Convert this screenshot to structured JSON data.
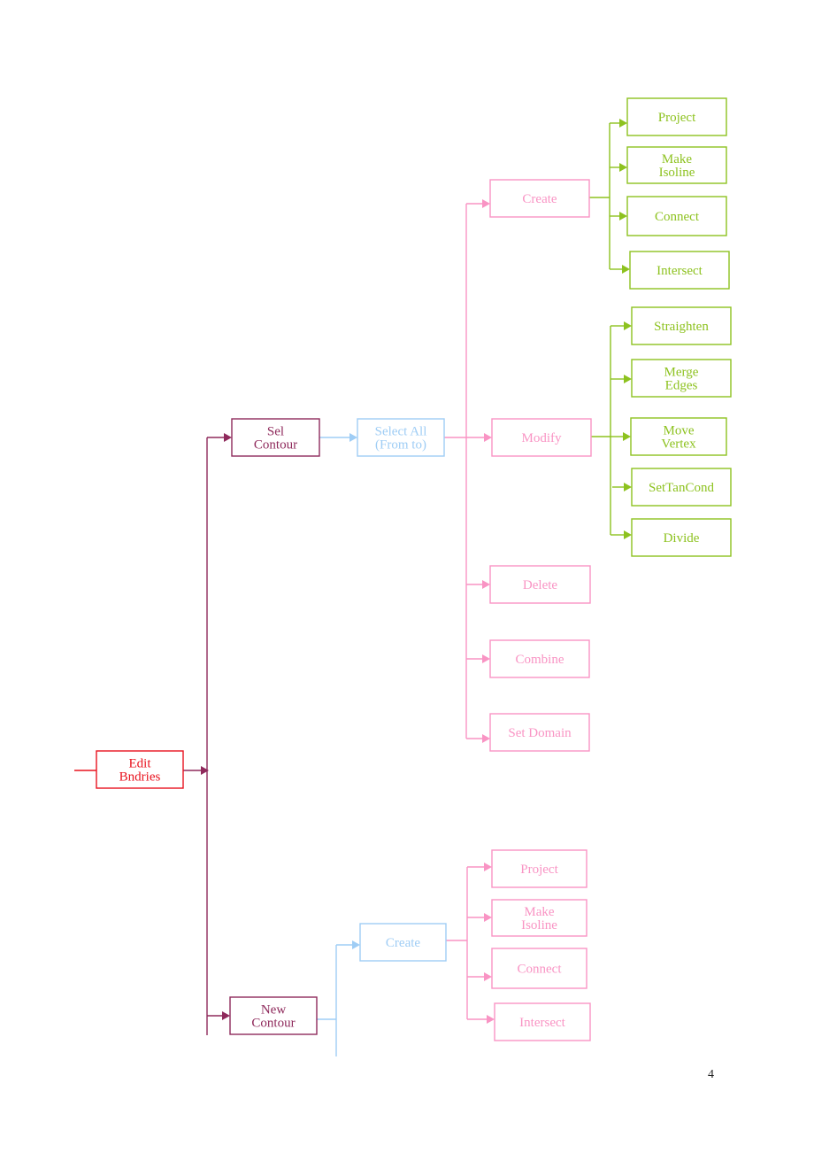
{
  "colors": {
    "root": "#e8121e",
    "level1": "#8f2a5c",
    "level2": "#9fcdf5",
    "level3": "#f994c4",
    "level4": "#8dc21f"
  },
  "nodes": {
    "edit_bndries": [
      "Edit",
      "Bndries"
    ],
    "sel_contour": [
      "Sel",
      "Contour"
    ],
    "new_contour": [
      "New",
      "Contour"
    ],
    "select_all": [
      "Select All",
      "(From to)"
    ],
    "create_new": [
      "Create"
    ],
    "create": [
      "Create"
    ],
    "modify": [
      "Modify"
    ],
    "delete": [
      "Delete"
    ],
    "combine": [
      "Combine"
    ],
    "set_domain": [
      "Set Domain"
    ],
    "c_project": [
      "Project"
    ],
    "c_make_isoline": [
      "Make",
      "Isoline"
    ],
    "c_connect": [
      "Connect"
    ],
    "c_intersect": [
      "Intersect"
    ],
    "m_straighten": [
      "Straighten"
    ],
    "m_merge_edges": [
      "Merge",
      "Edges"
    ],
    "m_move_vertex": [
      "Move",
      "Vertex"
    ],
    "m_settancond": [
      "SetTanCond"
    ],
    "m_divide": [
      "Divide"
    ],
    "n_project": [
      "Project"
    ],
    "n_make_isoline": [
      "Make",
      "Isoline"
    ],
    "n_connect": [
      "Connect"
    ],
    "n_intersect": [
      "Intersect"
    ]
  },
  "page_number": "4"
}
